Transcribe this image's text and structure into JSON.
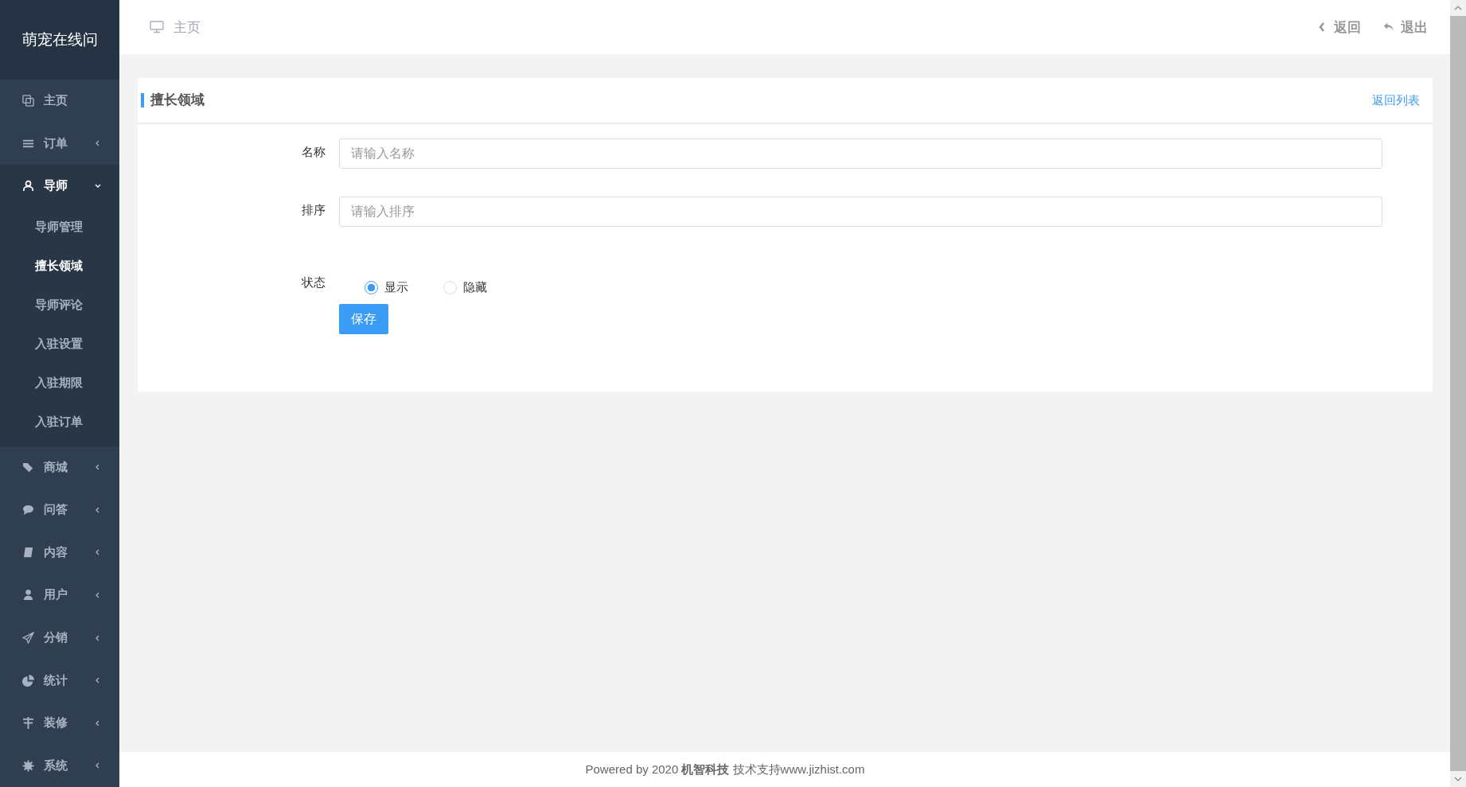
{
  "sidebar": {
    "logo": "萌宠在线问",
    "items": [
      {
        "label": "主页"
      },
      {
        "label": "订单",
        "expanded": false
      },
      {
        "label": "导师",
        "expanded": true,
        "children": [
          {
            "label": "导师管理",
            "selected": false
          },
          {
            "label": "擅长领域",
            "selected": true
          },
          {
            "label": "导师评论",
            "selected": false
          },
          {
            "label": "入驻设置",
            "selected": false
          },
          {
            "label": "入驻期限",
            "selected": false
          },
          {
            "label": "入驻订单",
            "selected": false
          }
        ]
      },
      {
        "label": "商城",
        "expanded": false
      },
      {
        "label": "问答",
        "expanded": false
      },
      {
        "label": "内容",
        "expanded": false
      },
      {
        "label": "用户",
        "expanded": false
      },
      {
        "label": "分销",
        "expanded": false
      },
      {
        "label": "统计",
        "expanded": false
      },
      {
        "label": "装修",
        "expanded": false
      },
      {
        "label": "系统",
        "expanded": false
      }
    ]
  },
  "topbar": {
    "breadcrumb": "主页",
    "back": "返回",
    "logout": "退出"
  },
  "card": {
    "title": "擅长领域",
    "back_link": "返回列表",
    "fields": [
      {
        "kind": "input",
        "label": "名称",
        "placeholder": "请输入名称"
      },
      {
        "kind": "input",
        "label": "排序",
        "placeholder": "请输入排序"
      },
      {
        "kind": "radio",
        "label": "状态",
        "options": [
          {
            "label": "显示",
            "selected": true
          },
          {
            "label": "隐藏",
            "selected": false
          }
        ]
      }
    ],
    "save": "保存"
  },
  "footer": "Powered by 2020 **机智科技** 技术支持www.jizhist.com"
}
